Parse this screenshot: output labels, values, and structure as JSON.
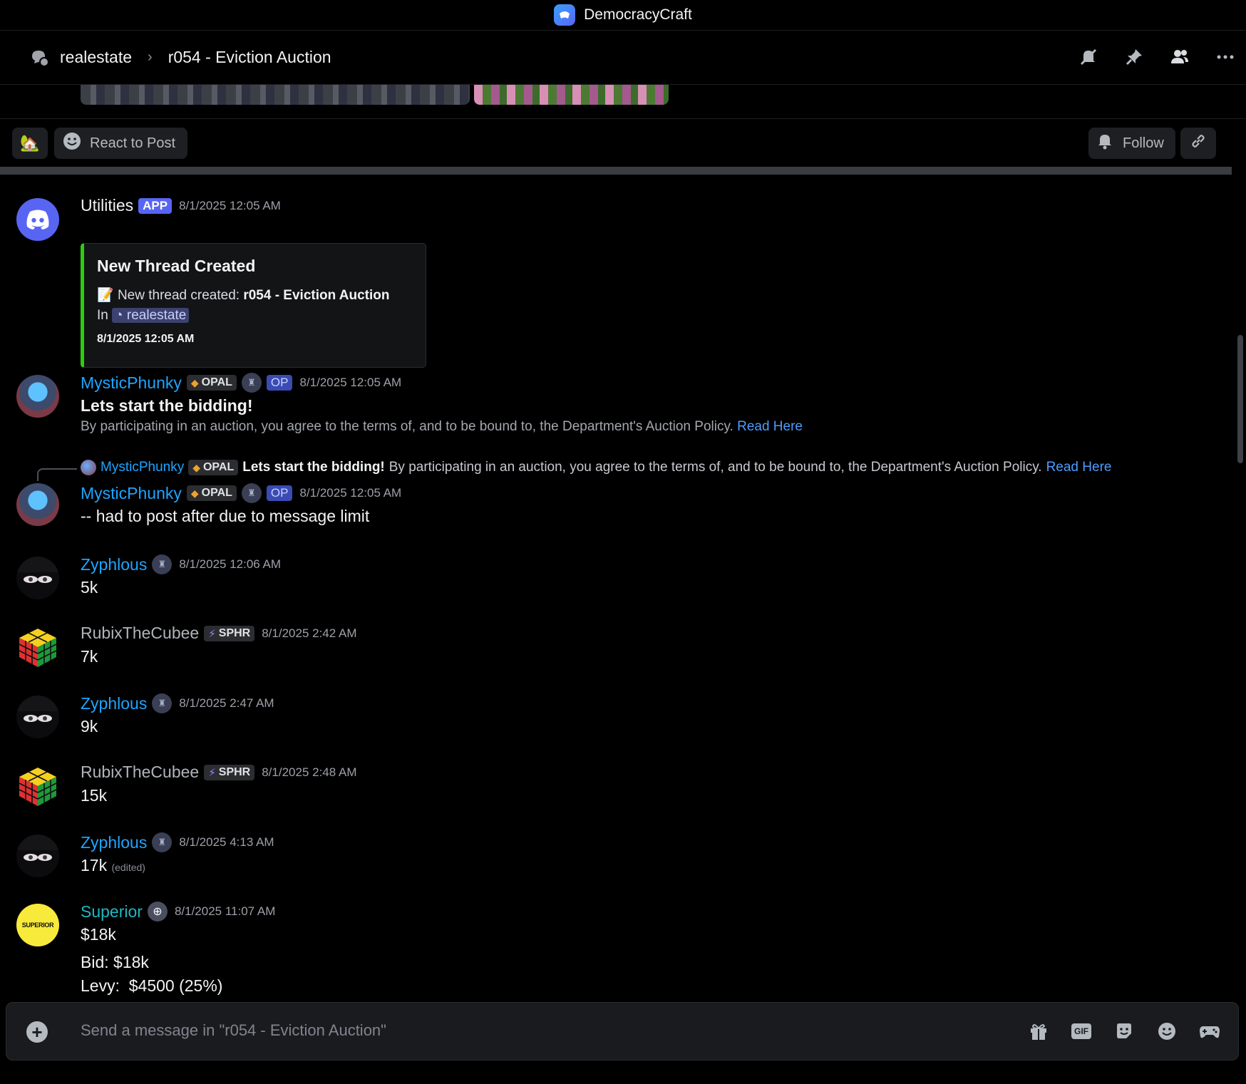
{
  "window": {
    "title": "DemocracyCraft"
  },
  "header": {
    "parent": "realestate",
    "thread": "r054 - Eviction Auction"
  },
  "post_bar": {
    "react_label": "React to Post",
    "follow_label": "Follow"
  },
  "messages": [
    {
      "author": "Utilities",
      "badge": "APP",
      "time": "8/1/2025 12:05 AM",
      "embed": {
        "title": "New Thread Created",
        "line1_prefix": "New thread created: ",
        "line1_bold": "r054 - Eviction Auction",
        "line2_prefix": "In",
        "channel": "realestate",
        "time": "8/1/2025 12:05 AM"
      }
    },
    {
      "author": "MysticPhunky",
      "tag": "OPAL",
      "op": "OP",
      "time": "8/1/2025 12:05 AM",
      "title": "Lets start the bidding!",
      "policy": "By participating in an auction, you agree to the terms of, and to be bound to, the Department's Auction Policy.",
      "link": "Read Here"
    },
    {
      "reply": {
        "author": "MysticPhunky",
        "tag": "OPAL",
        "bold": "Lets start the bidding!",
        "text": "By participating in an auction, you agree to the terms of, and to be bound to, the Department's Auction Policy.",
        "link": "Read Here"
      },
      "author": "MysticPhunky",
      "tag": "OPAL",
      "op": "OP",
      "time": "8/1/2025 12:05 AM",
      "text": "-- had to post after due to message limit"
    },
    {
      "author": "Zyphlous",
      "time": "8/1/2025 12:06 AM",
      "text": "5k"
    },
    {
      "author": "RubixTheCubee",
      "tag": "SPHR",
      "time": "8/1/2025 2:42 AM",
      "text": "7k"
    },
    {
      "author": "Zyphlous",
      "time": "8/1/2025 2:47 AM",
      "text": "9k"
    },
    {
      "author": "RubixTheCubee",
      "tag": "SPHR",
      "time": "8/1/2025 2:48 AM",
      "text": "15k"
    },
    {
      "author": "Zyphlous",
      "time": "8/1/2025 4:13 AM",
      "text": "17k",
      "edited": "(edited)"
    },
    {
      "author": "Superior",
      "avatar_text": "SUPERIOR",
      "time": "8/1/2025 11:07 AM",
      "text": "$18k",
      "line2": "Bid: $18k",
      "line3": "Levy:  $4500 (25%)"
    }
  ],
  "composer": {
    "placeholder": "Send a message in \"r054 - Eviction Auction\""
  },
  "colors": {
    "accent": "#5865f2",
    "link": "#4d9cff",
    "embed_bar": "#2ecc11",
    "name_blue": "#1ea5ff"
  }
}
